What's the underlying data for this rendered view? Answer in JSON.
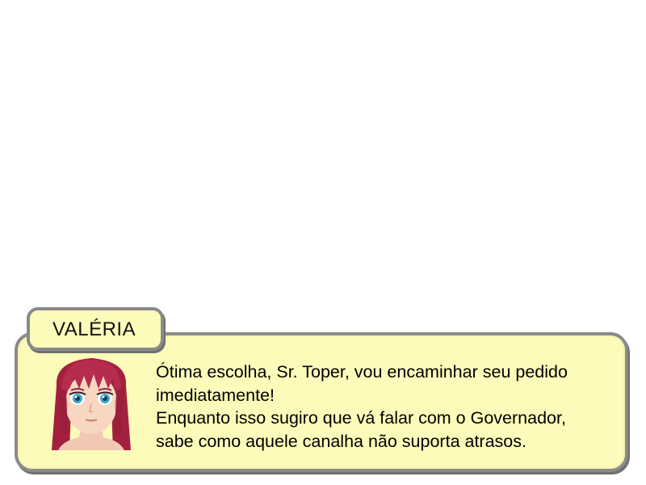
{
  "dialog": {
    "speaker": "VALÉRIA",
    "lines": [
      "Ótima escolha, Sr. Toper, vou encaminhar seu pedido",
      "imediatamente!",
      "Enquanto isso sugiro que vá falar com o Governador,",
      "sabe como aquele canalha não suporta atrasos."
    ],
    "portrait": "red-haired-girl-portrait"
  },
  "colors": {
    "box_fill": "#fdfbba",
    "box_border": "#8a8a8a",
    "hair": "#b02a4a",
    "eyes": "#3aa7c9"
  }
}
